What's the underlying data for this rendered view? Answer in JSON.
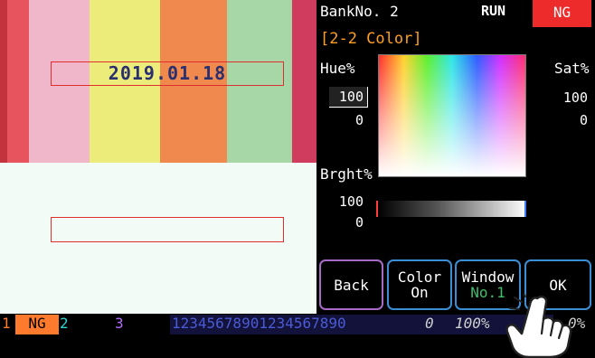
{
  "preview": {
    "date_text": "2019.01.18"
  },
  "panel": {
    "bank_label": "BankNo. 2",
    "run_label": "RUN",
    "result_label": "NG",
    "section_title": "[2-2 Color]",
    "hue_label": "Hue%",
    "hue_max": "100",
    "hue_min": "0",
    "sat_label": "Sat%",
    "sat_max": "100",
    "sat_min": "0",
    "brght_label": "Brght%",
    "brght_max": "100",
    "brght_min": "0"
  },
  "buttons": {
    "back": "Back",
    "color_line1": "Color",
    "color_line2": "On",
    "window_line1": "Window",
    "window_line2": "No.1",
    "ok": "OK"
  },
  "status": {
    "s1_num": "1",
    "s1_val": "NG",
    "s2_num": "2",
    "s3_num": "3",
    "digits": "12345678901234567890",
    "zero": "0",
    "pct": "100%",
    "pct2": "0%"
  },
  "colors": {
    "accent_blue": "#3b8ed4",
    "ng_red": "#ee2b2b",
    "title_orange": "#ff9e23",
    "status_orange": "#ff7a2d",
    "status_teal": "#2bd6d0",
    "status_purple": "#b46bff"
  },
  "icons": {
    "pointer": "pointing-hand-icon"
  }
}
